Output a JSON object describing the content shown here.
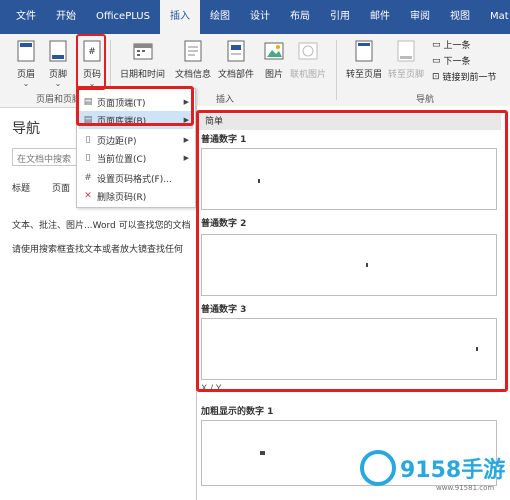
{
  "tabs": [
    {
      "label": "文件"
    },
    {
      "label": "开始"
    },
    {
      "label": "OfficePLUS"
    },
    {
      "label": "插入"
    },
    {
      "label": "绘图"
    },
    {
      "label": "设计"
    },
    {
      "label": "布局"
    },
    {
      "label": "引用"
    },
    {
      "label": "邮件"
    },
    {
      "label": "审阅"
    },
    {
      "label": "视图"
    },
    {
      "label": "Mat"
    }
  ],
  "ribbon": {
    "header": "页眉",
    "footer": "页脚",
    "page_number": "页码",
    "datetime": "日期和时间",
    "doc_info": "文档信息",
    "doc_parts": "文档部件",
    "picture": "图片",
    "online_picture": "联机图片",
    "goto_header": "转至页眉",
    "goto_footer": "转至页脚",
    "prev": "上一条",
    "next": "下一条",
    "link_prev": "链接到前一节",
    "group_header_footer": "页眉和页脚",
    "group_insert": "插入",
    "group_nav": "导航"
  },
  "nav": {
    "title": "导航",
    "search_placeholder": "在文档中搜索",
    "tab_headings": "标题",
    "tab_pages": "页面",
    "line1": "文本、批注、图片...Word 可以查找您的文档",
    "line2": "请使用搜索框查找文本或者放大镜查找任何"
  },
  "menu": {
    "items": [
      {
        "label": "页面顶端(T)"
      },
      {
        "label": "页面底端(B)"
      },
      {
        "label": "页边距(P)"
      },
      {
        "label": "当前位置(C)"
      },
      {
        "label": "设置页码格式(F)..."
      },
      {
        "label": "删除页码(R)"
      }
    ]
  },
  "gallery": {
    "section": "简单",
    "item1": "普通数字 1",
    "item2": "普通数字 2",
    "item3": "普通数字 3",
    "item4": "加粗显示的数字 1",
    "divider": "X / Y"
  },
  "watermark": {
    "brand": "9158手游",
    "url": "www.91581.com"
  },
  "colors": {
    "ribbon_blue": "#2b579a",
    "highlight_red": "#e02020",
    "menu_hover": "#cfe3f6"
  }
}
